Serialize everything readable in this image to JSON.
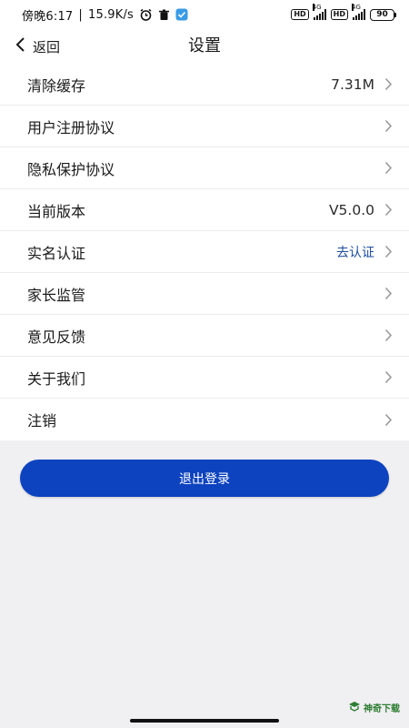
{
  "status_bar": {
    "time": "傍晚6:17",
    "separator": "|",
    "network_speed": "15.9K/s",
    "battery": "90",
    "hd1": "HD",
    "hd2": "HD",
    "g1": "4G",
    "g2": "4G"
  },
  "header": {
    "back_label": "返回",
    "title": "设置"
  },
  "settings": {
    "items": [
      {
        "label": "清除缓存",
        "value": "7.31M"
      },
      {
        "label": "用户注册协议",
        "value": ""
      },
      {
        "label": "隐私保护协议",
        "value": ""
      },
      {
        "label": "当前版本",
        "value": "V5.0.0"
      },
      {
        "label": "实名认证",
        "value": "去认证"
      },
      {
        "label": "家长监管",
        "value": ""
      },
      {
        "label": "意见反馈",
        "value": ""
      },
      {
        "label": "关于我们",
        "value": ""
      },
      {
        "label": "注销",
        "value": ""
      }
    ]
  },
  "logout_label": "退出登录",
  "watermark": "神奇下载",
  "colors": {
    "accent": "#0d43bf",
    "link": "#1e4d9e",
    "background": "#f0eff2"
  }
}
